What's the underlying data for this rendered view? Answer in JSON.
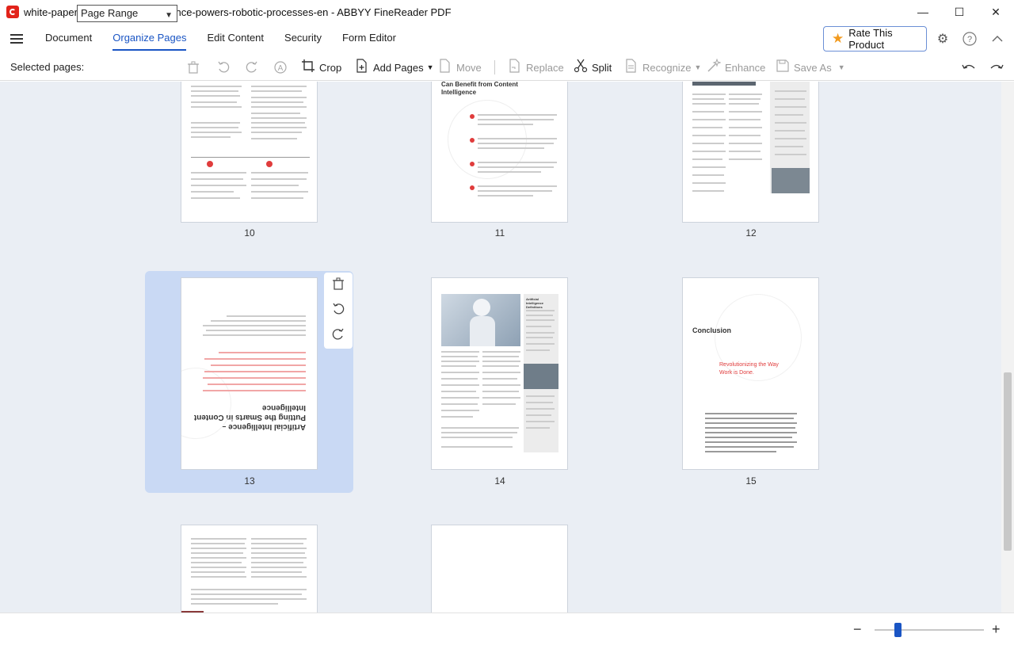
{
  "window": {
    "title": "white-paper-how-content-intelligence-powers-robotic-processes-en - ABBYY FineReader PDF",
    "controls": [
      "—",
      "☐",
      "✕"
    ]
  },
  "menu": {
    "tabs": [
      "Document",
      "Organize Pages",
      "Edit Content",
      "Security",
      "Form Editor"
    ],
    "active_tab": "Organize Pages",
    "rate_label": "Rate This Product"
  },
  "toolbar": {
    "selected_label": "Selected pages:",
    "range_value": "Page Range",
    "crop": "Crop",
    "add_pages": "Add Pages",
    "move": "Move",
    "replace": "Replace",
    "split": "Split",
    "recognize": "Recognize",
    "enhance": "Enhance",
    "save_as": "Save As"
  },
  "pages": {
    "p10": "10",
    "p11": "11",
    "p12": "12",
    "p13": "13",
    "p14": "14",
    "p15": "15",
    "p11_heading_a": "Can Benefit from Content",
    "p11_heading_b": "Intelligence",
    "p13_title_a": "Artificial Intelligence –",
    "p13_title_b": "Putting the Smarts in Content",
    "p13_title_c": "Intelligence",
    "p15_heading": "Conclusion",
    "p15_sub_a": "Revolutionizing the Way",
    "p15_sub_b": "Work is Done.",
    "p14_sidebar_heading": "Artificial Intelligence Definitions"
  },
  "colors": {
    "accent": "#1a55c4",
    "selection": "#c9d9f4",
    "brand_red": "#e2231a"
  }
}
